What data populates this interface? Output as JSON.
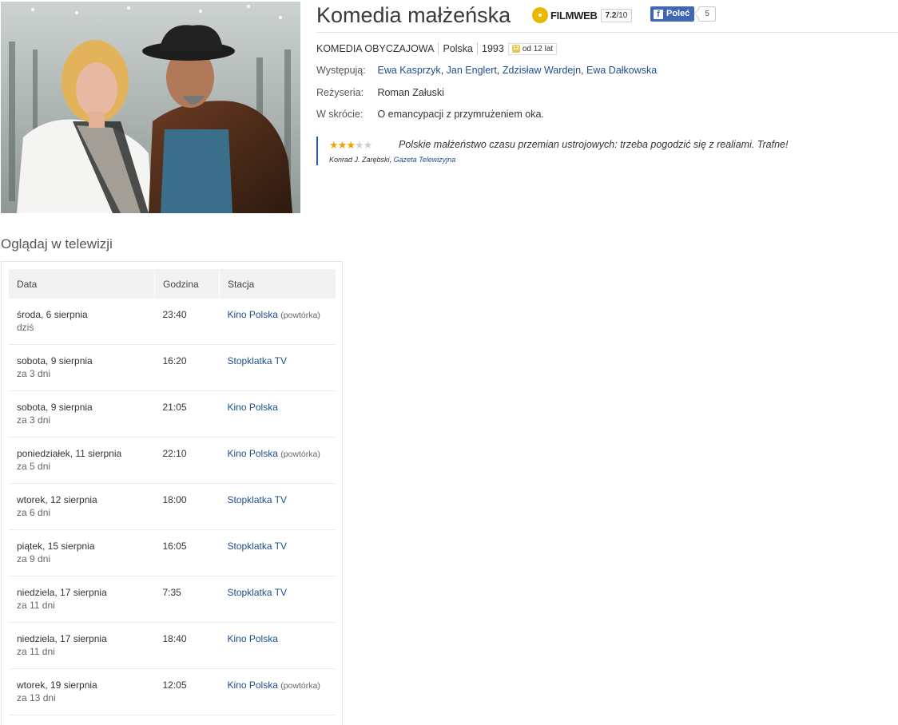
{
  "movie": {
    "title": "Komedia małżeńska",
    "genre": "KOMEDIA OBYCZAJOWA",
    "country": "Polska",
    "year": "1993",
    "age_icon": "12",
    "age_rating": "od 12 lat",
    "poster_icon": "film-still"
  },
  "filmweb": {
    "label": "FILMWEB",
    "score": "7.2",
    "score_max": "/10",
    "icon": "filmweb-logo-icon",
    "color": "#e8b800"
  },
  "facebook": {
    "icon_letter": "f",
    "button_label": "Poleć",
    "count": "5",
    "color": "#4267b2"
  },
  "info": {
    "cast_label": "Występują:",
    "cast": [
      "Ewa Kasprzyk",
      "Jan Englert",
      "Zdzisław Wardejn",
      "Ewa Dałkowska"
    ],
    "cast_sep": ",",
    "director_label": "Reżyseria:",
    "director": "Roman Załuski",
    "summary_label": "W skrócie:",
    "summary": "O emancypacji z przymrużeniem oka."
  },
  "review": {
    "stars_filled": 3,
    "stars_total": 5,
    "quote": "Polskie małżeństwo czasu przemian ustrojowych: trzeba pogodzić się z realiami. Trafne!",
    "author": "Konrad J. Zarębski",
    "author_sep": ",",
    "source": "Gazeta Telewizyjna",
    "accent_color": "#2a5aa0"
  },
  "tv": {
    "section_title": "Oglądaj w telewizji",
    "headers": {
      "date": "Data",
      "time": "Godzina",
      "station": "Stacja"
    },
    "rows": [
      {
        "date": "środa, 6 sierpnia",
        "rel": "dziś",
        "time": "23:40",
        "station": "Kino Polska",
        "note": "(powtórka)"
      },
      {
        "date": "sobota, 9 sierpnia",
        "rel": "za 3 dni",
        "time": "16:20",
        "station": "Stopklatka TV",
        "note": ""
      },
      {
        "date": "sobota, 9 sierpnia",
        "rel": "za 3 dni",
        "time": "21:05",
        "station": "Kino Polska",
        "note": ""
      },
      {
        "date": "poniedziałek, 11 sierpnia",
        "rel": "za 5 dni",
        "time": "22:10",
        "station": "Kino Polska",
        "note": "(powtórka)"
      },
      {
        "date": "wtorek, 12 sierpnia",
        "rel": "za 6 dni",
        "time": "18:00",
        "station": "Stopklatka TV",
        "note": ""
      },
      {
        "date": "piątek, 15 sierpnia",
        "rel": "za 9 dni",
        "time": "16:05",
        "station": "Stopklatka TV",
        "note": ""
      },
      {
        "date": "niedziela, 17 sierpnia",
        "rel": "za 11 dni",
        "time": "7:35",
        "station": "Stopklatka TV",
        "note": ""
      },
      {
        "date": "niedziela, 17 sierpnia",
        "rel": "za 11 dni",
        "time": "18:40",
        "station": "Kino Polska",
        "note": ""
      },
      {
        "date": "wtorek, 19 sierpnia",
        "rel": "za 13 dni",
        "time": "12:05",
        "station": "Kino Polska",
        "note": "(powtórka)"
      }
    ]
  },
  "colors": {
    "link": "#1e4e8c",
    "star": "#f0a30a",
    "table_header_bg": "#f2f2f2"
  }
}
